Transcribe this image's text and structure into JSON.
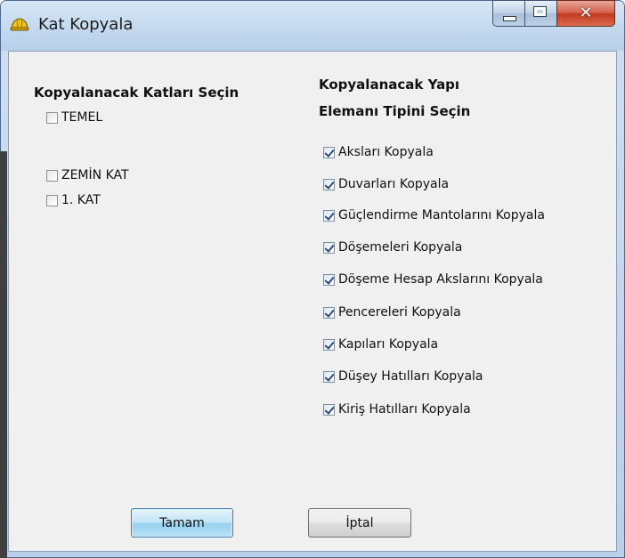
{
  "window": {
    "title": "Kat Kopyala"
  },
  "floors": {
    "heading": "Kopyalanacak Katları Seçin",
    "items": [
      {
        "label": "TEMEL",
        "checked": false
      },
      {
        "label": "ZEMİN KAT",
        "checked": false
      },
      {
        "label": "1. KAT",
        "checked": false
      }
    ]
  },
  "elements": {
    "heading_line1": "Kopyalanacak Yapı",
    "heading_line2": "Elemanı Tipini Seçin",
    "items": [
      {
        "label": "Aksları Kopyala",
        "checked": true
      },
      {
        "label": "Duvarları Kopyala",
        "checked": true
      },
      {
        "label": "Güçlendirme Mantolarını Kopyala",
        "checked": true
      },
      {
        "label": "Döşemeleri Kopyala",
        "checked": true
      },
      {
        "label": "Döşeme Hesap Akslarını Kopyala",
        "checked": true
      },
      {
        "label": "Pencereleri Kopyala",
        "checked": true
      },
      {
        "label": "Kapıları Kopyala",
        "checked": true
      },
      {
        "label": "Düşey Hatılları Kopyala",
        "checked": true
      },
      {
        "label": "Kiriş Hatılları Kopyala",
        "checked": true
      }
    ]
  },
  "buttons": {
    "ok": "Tamam",
    "cancel": "İptal"
  }
}
